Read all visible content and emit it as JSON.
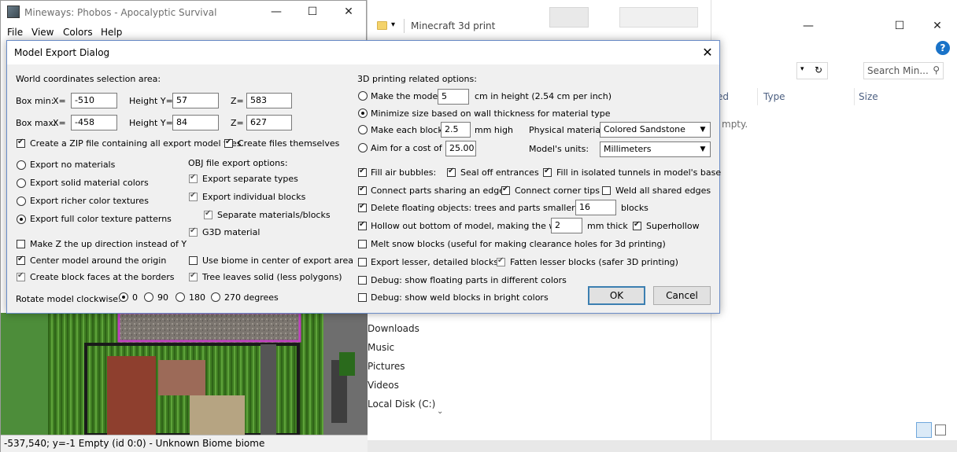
{
  "explorer": {
    "title": "Minecraft 3d print",
    "search_placeholder": "Search Min...",
    "columns": [
      "ed",
      "Type",
      "Size"
    ],
    "empty_text": "mpty.",
    "nav_items": [
      "Downloads",
      "Music",
      "Pictures",
      "Videos",
      "Local Disk (C:)"
    ],
    "minimize": "—",
    "maximize": "☐",
    "close": "✕",
    "help": "?"
  },
  "mineways": {
    "title": "Mineways: Phobos - Apocalyptic Survival",
    "menu": [
      "File",
      "View",
      "Colors",
      "Help"
    ],
    "minimize": "—",
    "maximize": "☐",
    "close": "✕",
    "status": "-537,540; y=-1 Empty (id 0:0) - Unknown Biome biome"
  },
  "dialog": {
    "title": "Model Export Dialog",
    "close": "✕",
    "world": {
      "heading": "World coordinates selection area:",
      "box_min_label": "Box min:",
      "box_max_label": "Box max:",
      "x_label": "X=",
      "height_label": "Height Y=",
      "z_label": "Z=",
      "min_x": "-510",
      "min_y": "57",
      "min_z": "583",
      "max_x": "-458",
      "max_y": "84",
      "max_z": "627"
    },
    "zip_label": "Create a ZIP file containing all export model files",
    "create_files_label": "Create files themselves",
    "materials": [
      {
        "label": "Export no materials",
        "checked": false
      },
      {
        "label": "Export solid material colors",
        "checked": false
      },
      {
        "label": "Export richer color textures",
        "checked": false
      },
      {
        "label": "Export full color texture patterns",
        "checked": true
      }
    ],
    "obj": {
      "heading": "OBJ file export options:",
      "separate_types": "Export separate types",
      "individual_blocks": "Export individual blocks",
      "separate_materials": "Separate materials/blocks",
      "g3d": "G3D material"
    },
    "make_z_up": "Make Z the up direction instead of Y",
    "center_model": "Center model around the origin",
    "block_faces": "Create block faces at the borders",
    "use_biome": "Use biome in center of export area",
    "tree_leaves": "Tree leaves solid (less polygons)",
    "rotate": {
      "label": "Rotate model clockwise:",
      "options": [
        "0",
        "90",
        "180",
        "270 degrees"
      ]
    },
    "printing": {
      "heading": "3D printing related options:",
      "make_model": "Make the model",
      "height_value": "5",
      "height_unit": "cm in height (2.54 cm per inch)",
      "minimize_size": "Minimize size based on wall thickness for material type",
      "make_each_block": "Make each block",
      "block_value": "2.5",
      "block_unit": "mm high",
      "physical_material_label": "Physical material:",
      "physical_material_value": "Colored Sandstone",
      "aim_cost": "Aim for a cost of $",
      "cost_value": "25.00",
      "units_label": "Model's units:",
      "units_value": "Millimeters"
    },
    "fill_air": "Fill air bubbles:",
    "seal_off": "Seal off entrances",
    "fill_tunnels": "Fill in isolated tunnels in model's base",
    "connect_parts": "Connect parts sharing an edge:",
    "connect_corner": "Connect corner tips",
    "weld_all": "Weld all shared edges",
    "delete_floating": "Delete floating objects: trees and parts smaller than",
    "floating_value": "16",
    "floating_unit": "blocks",
    "hollow_out": "Hollow out bottom of model, making the walls",
    "hollow_value": "2",
    "hollow_unit": "mm thick",
    "superhollow": "Superhollow",
    "melt_snow": "Melt snow blocks (useful for making clearance holes for 3d printing)",
    "export_lesser": "Export lesser, detailed blocks:",
    "fatten_lesser": "Fatten lesser blocks (safer 3D printing)",
    "debug_floating": "Debug: show floating parts in different colors",
    "debug_weld": "Debug: show weld blocks in bright colors",
    "ok_label": "OK",
    "cancel_label": "Cancel"
  }
}
